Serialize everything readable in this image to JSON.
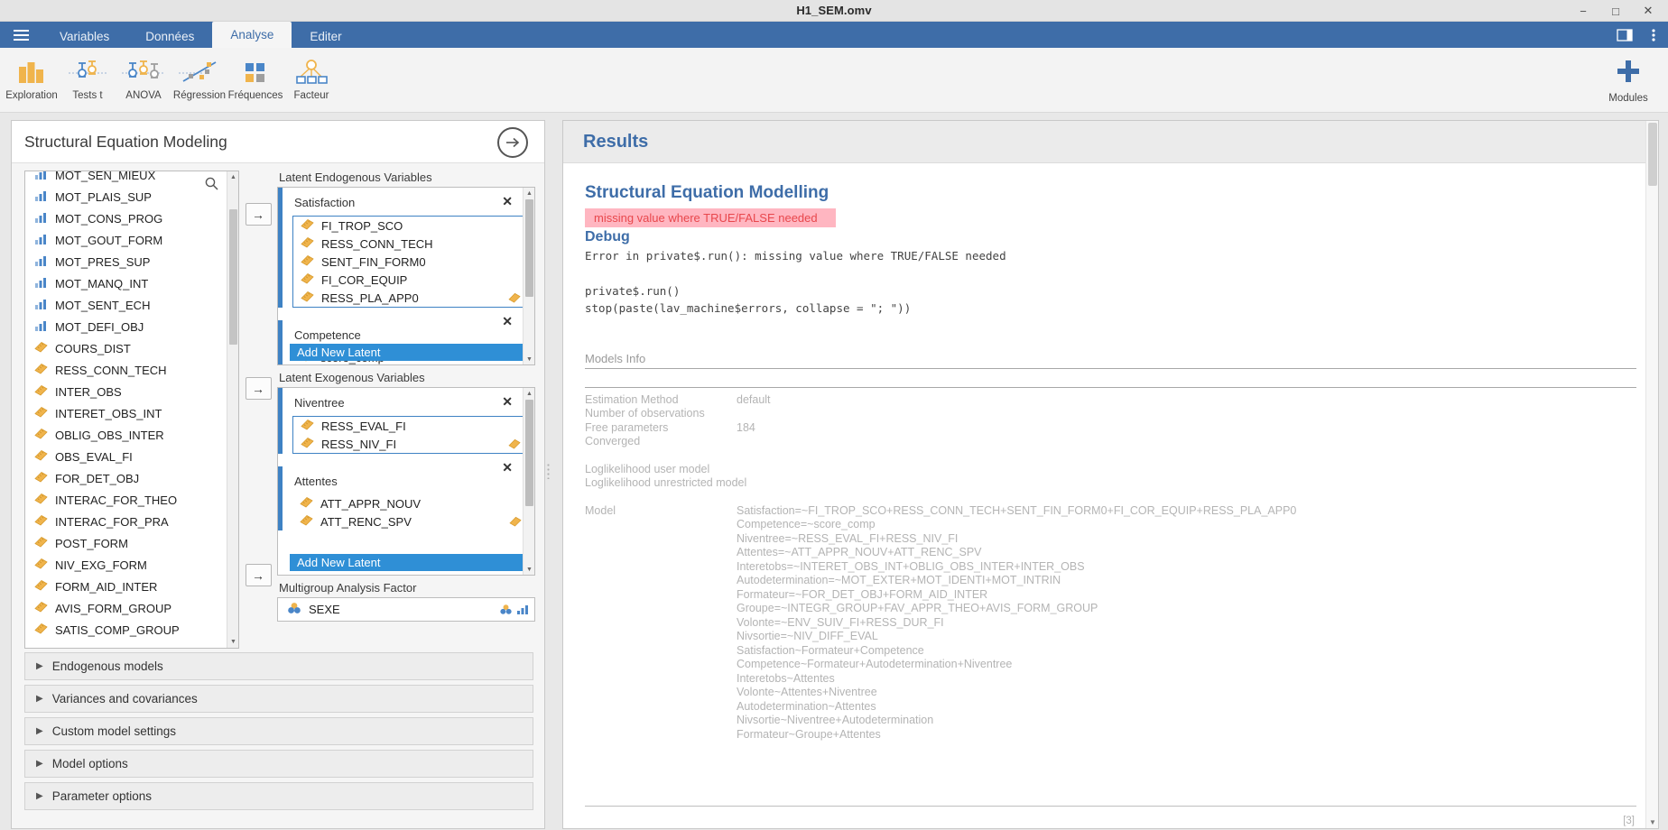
{
  "window": {
    "title": "H1_SEM.omv",
    "minimize": "−",
    "maximize": "□",
    "close": "✕"
  },
  "tabs": [
    {
      "label": "Variables",
      "active": false
    },
    {
      "label": "Données",
      "active": false
    },
    {
      "label": "Analyse",
      "active": true
    },
    {
      "label": "Editer",
      "active": false
    }
  ],
  "ribbon": {
    "items": [
      {
        "label": "Exploration",
        "icon": "bar-chart-icon"
      },
      {
        "label": "Tests t",
        "icon": "t-test-icon"
      },
      {
        "label": "ANOVA",
        "icon": "anova-icon"
      },
      {
        "label": "Régression",
        "icon": "regression-icon"
      },
      {
        "label": "Fréquences",
        "icon": "frequencies-icon"
      },
      {
        "label": "Facteur",
        "icon": "factor-icon"
      }
    ],
    "modules": {
      "label": "Modules",
      "icon": "plus-icon"
    }
  },
  "options": {
    "title": "Structural Equation Modeling",
    "collapse_arrow": "→",
    "search_icon": "search-icon",
    "variables": [
      {
        "name": "MOT_SEN_MIEUX",
        "type": "nominal"
      },
      {
        "name": "MOT_PLAIS_SUP",
        "type": "nominal"
      },
      {
        "name": "MOT_CONS_PROG",
        "type": "nominal"
      },
      {
        "name": "MOT_GOUT_FORM",
        "type": "nominal"
      },
      {
        "name": "MOT_PRES_SUP",
        "type": "nominal"
      },
      {
        "name": "MOT_MANQ_INT",
        "type": "nominal"
      },
      {
        "name": "MOT_SENT_ECH",
        "type": "nominal"
      },
      {
        "name": "MOT_DEFI_OBJ",
        "type": "nominal"
      },
      {
        "name": "COURS_DIST",
        "type": "continuous"
      },
      {
        "name": "RESS_CONN_TECH",
        "type": "continuous"
      },
      {
        "name": "INTER_OBS",
        "type": "continuous"
      },
      {
        "name": "INTERET_OBS_INT",
        "type": "continuous"
      },
      {
        "name": "OBLIG_OBS_INTER",
        "type": "continuous"
      },
      {
        "name": "OBS_EVAL_FI",
        "type": "continuous"
      },
      {
        "name": "FOR_DET_OBJ",
        "type": "continuous"
      },
      {
        "name": "INTERAC_FOR_THEO",
        "type": "continuous"
      },
      {
        "name": "INTERAC_FOR_PRA",
        "type": "continuous"
      },
      {
        "name": "POST_FORM",
        "type": "continuous"
      },
      {
        "name": "NIV_EXG_FORM",
        "type": "continuous"
      },
      {
        "name": "FORM_AID_INTER",
        "type": "continuous"
      },
      {
        "name": "AVIS_FORM_GROUP",
        "type": "continuous"
      },
      {
        "name": "SATIS_COMP_GROUP",
        "type": "continuous"
      }
    ],
    "endogenous": {
      "label": "Latent Endogenous Variables",
      "transfer": "→",
      "add_new": "Add New Latent",
      "groups": [
        {
          "name": "Satisfaction",
          "close": "✕",
          "items": [
            {
              "name": "FI_TROP_SCO",
              "type": "continuous"
            },
            {
              "name": "RESS_CONN_TECH",
              "type": "continuous"
            },
            {
              "name": "SENT_FIN_FORM0",
              "type": "continuous"
            },
            {
              "name": "FI_COR_EQUIP",
              "type": "continuous"
            },
            {
              "name": "RESS_PLA_APP0",
              "type": "continuous"
            }
          ]
        },
        {
          "name": "Competence",
          "close": "✕",
          "items": [
            {
              "name": "score_comp",
              "type": "continuous"
            }
          ]
        }
      ]
    },
    "exogenous": {
      "label": "Latent Exogenous Variables",
      "transfer": "→",
      "add_new": "Add New Latent",
      "groups": [
        {
          "name": "Niventree",
          "close": "✕",
          "items": [
            {
              "name": "RESS_EVAL_FI",
              "type": "continuous"
            },
            {
              "name": "RESS_NIV_FI",
              "type": "continuous"
            }
          ]
        },
        {
          "name": "Attentes",
          "close": "✕",
          "items": [
            {
              "name": "ATT_APPR_NOUV",
              "type": "continuous"
            },
            {
              "name": "ATT_RENC_SPV",
              "type": "continuous"
            }
          ]
        }
      ]
    },
    "multigroup": {
      "label": "Multigroup Analysis Factor",
      "transfer": "→",
      "value": "SEXE",
      "icon": "nominal-group-icon"
    },
    "sections": [
      {
        "label": "Endogenous models",
        "expanded": false
      },
      {
        "label": "Variances and covariances",
        "expanded": false
      },
      {
        "label": "Custom model settings",
        "expanded": false
      },
      {
        "label": "Model options",
        "expanded": false
      },
      {
        "label": "Parameter options",
        "expanded": false
      }
    ]
  },
  "results": {
    "header": "Results",
    "analysis_title": "Structural Equation Modelling",
    "error_message": "missing value where TRUE/FALSE needed",
    "debug_heading": "Debug",
    "debug_text": "Error in private$.run(): missing value where TRUE/FALSE needed\n\nprivate$.run()\nstop(paste(lav_machine$errors, collapse = \"; \"))",
    "models_info": {
      "title": "Models Info",
      "rows": [
        {
          "key": "Estimation Method",
          "value": "default"
        },
        {
          "key": "Number of observations",
          "value": ""
        },
        {
          "key": "Free parameters",
          "value": "184"
        },
        {
          "key": "Converged",
          "value": ""
        },
        {
          "key": "",
          "value": ""
        },
        {
          "key": "Loglikelihood user model",
          "value": ""
        },
        {
          "key": "Loglikelihood unrestricted model",
          "value": ""
        }
      ],
      "model_key": "Model",
      "model_equations": [
        "Satisfaction=~FI_TROP_SCO+RESS_CONN_TECH+SENT_FIN_FORM0+FI_COR_EQUIP+RESS_PLA_APP0",
        "Competence=~score_comp",
        "Niventree=~RESS_EVAL_FI+RESS_NIV_FI",
        "Attentes=~ATT_APPR_NOUV+ATT_RENC_SPV",
        "Interetobs=~INTERET_OBS_INT+OBLIG_OBS_INTER+INTER_OBS",
        "Autodetermination=~MOT_EXTER+MOT_IDENTI+MOT_INTRIN",
        "Formateur=~FOR_DET_OBJ+FORM_AID_INTER",
        "Groupe=~INTEGR_GROUP+FAV_APPR_THEO+AVIS_FORM_GROUP",
        "Volonte=~ENV_SUIV_FI+RESS_DUR_FI",
        "Nivsortie=~NIV_DIFF_EVAL",
        "Satisfaction~Formateur+Competence",
        "Competence~Formateur+Autodetermination+Niventree",
        "Interetobs~Attentes",
        "Volonte~Attentes+Niventree",
        "Autodetermination~Attentes",
        "Nivsortie~Niventree+Autodetermination",
        "Formateur~Groupe+Attentes"
      ]
    },
    "reference_marker": "[3]"
  },
  "colors": {
    "brand_blue": "#3e6da8",
    "accent_blue": "#2f8fd6",
    "latent_strip": "#3e82c4",
    "error_bg": "#ffb6c1",
    "error_fg": "#e8474c",
    "icon_orange": "#f0b44c",
    "icon_blue": "#4a86c8"
  }
}
